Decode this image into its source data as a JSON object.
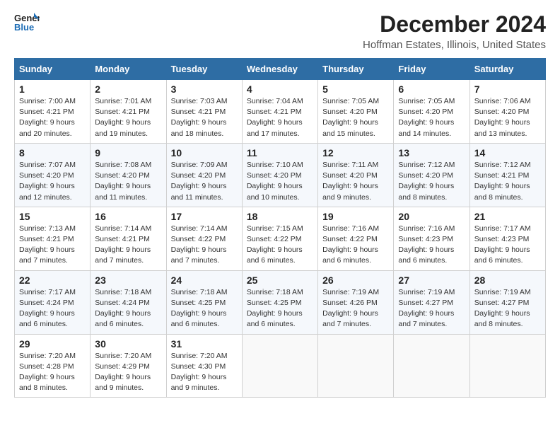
{
  "logo": {
    "line1": "General",
    "line2": "Blue"
  },
  "title": "December 2024",
  "location": "Hoffman Estates, Illinois, United States",
  "days_of_week": [
    "Sunday",
    "Monday",
    "Tuesday",
    "Wednesday",
    "Thursday",
    "Friday",
    "Saturday"
  ],
  "weeks": [
    [
      {
        "day": "1",
        "sunrise": "7:00 AM",
        "sunset": "4:21 PM",
        "daylight": "9 hours and 20 minutes."
      },
      {
        "day": "2",
        "sunrise": "7:01 AM",
        "sunset": "4:21 PM",
        "daylight": "9 hours and 19 minutes."
      },
      {
        "day": "3",
        "sunrise": "7:03 AM",
        "sunset": "4:21 PM",
        "daylight": "9 hours and 18 minutes."
      },
      {
        "day": "4",
        "sunrise": "7:04 AM",
        "sunset": "4:21 PM",
        "daylight": "9 hours and 17 minutes."
      },
      {
        "day": "5",
        "sunrise": "7:05 AM",
        "sunset": "4:20 PM",
        "daylight": "9 hours and 15 minutes."
      },
      {
        "day": "6",
        "sunrise": "7:05 AM",
        "sunset": "4:20 PM",
        "daylight": "9 hours and 14 minutes."
      },
      {
        "day": "7",
        "sunrise": "7:06 AM",
        "sunset": "4:20 PM",
        "daylight": "9 hours and 13 minutes."
      }
    ],
    [
      {
        "day": "8",
        "sunrise": "7:07 AM",
        "sunset": "4:20 PM",
        "daylight": "9 hours and 12 minutes."
      },
      {
        "day": "9",
        "sunrise": "7:08 AM",
        "sunset": "4:20 PM",
        "daylight": "9 hours and 11 minutes."
      },
      {
        "day": "10",
        "sunrise": "7:09 AM",
        "sunset": "4:20 PM",
        "daylight": "9 hours and 11 minutes."
      },
      {
        "day": "11",
        "sunrise": "7:10 AM",
        "sunset": "4:20 PM",
        "daylight": "9 hours and 10 minutes."
      },
      {
        "day": "12",
        "sunrise": "7:11 AM",
        "sunset": "4:20 PM",
        "daylight": "9 hours and 9 minutes."
      },
      {
        "day": "13",
        "sunrise": "7:12 AM",
        "sunset": "4:20 PM",
        "daylight": "9 hours and 8 minutes."
      },
      {
        "day": "14",
        "sunrise": "7:12 AM",
        "sunset": "4:21 PM",
        "daylight": "9 hours and 8 minutes."
      }
    ],
    [
      {
        "day": "15",
        "sunrise": "7:13 AM",
        "sunset": "4:21 PM",
        "daylight": "9 hours and 7 minutes."
      },
      {
        "day": "16",
        "sunrise": "7:14 AM",
        "sunset": "4:21 PM",
        "daylight": "9 hours and 7 minutes."
      },
      {
        "day": "17",
        "sunrise": "7:14 AM",
        "sunset": "4:22 PM",
        "daylight": "9 hours and 7 minutes."
      },
      {
        "day": "18",
        "sunrise": "7:15 AM",
        "sunset": "4:22 PM",
        "daylight": "9 hours and 6 minutes."
      },
      {
        "day": "19",
        "sunrise": "7:16 AM",
        "sunset": "4:22 PM",
        "daylight": "9 hours and 6 minutes."
      },
      {
        "day": "20",
        "sunrise": "7:16 AM",
        "sunset": "4:23 PM",
        "daylight": "9 hours and 6 minutes."
      },
      {
        "day": "21",
        "sunrise": "7:17 AM",
        "sunset": "4:23 PM",
        "daylight": "9 hours and 6 minutes."
      }
    ],
    [
      {
        "day": "22",
        "sunrise": "7:17 AM",
        "sunset": "4:24 PM",
        "daylight": "9 hours and 6 minutes."
      },
      {
        "day": "23",
        "sunrise": "7:18 AM",
        "sunset": "4:24 PM",
        "daylight": "9 hours and 6 minutes."
      },
      {
        "day": "24",
        "sunrise": "7:18 AM",
        "sunset": "4:25 PM",
        "daylight": "9 hours and 6 minutes."
      },
      {
        "day": "25",
        "sunrise": "7:18 AM",
        "sunset": "4:25 PM",
        "daylight": "9 hours and 6 minutes."
      },
      {
        "day": "26",
        "sunrise": "7:19 AM",
        "sunset": "4:26 PM",
        "daylight": "9 hours and 7 minutes."
      },
      {
        "day": "27",
        "sunrise": "7:19 AM",
        "sunset": "4:27 PM",
        "daylight": "9 hours and 7 minutes."
      },
      {
        "day": "28",
        "sunrise": "7:19 AM",
        "sunset": "4:27 PM",
        "daylight": "9 hours and 8 minutes."
      }
    ],
    [
      {
        "day": "29",
        "sunrise": "7:20 AM",
        "sunset": "4:28 PM",
        "daylight": "9 hours and 8 minutes."
      },
      {
        "day": "30",
        "sunrise": "7:20 AM",
        "sunset": "4:29 PM",
        "daylight": "9 hours and 9 minutes."
      },
      {
        "day": "31",
        "sunrise": "7:20 AM",
        "sunset": "4:30 PM",
        "daylight": "9 hours and 9 minutes."
      },
      null,
      null,
      null,
      null
    ]
  ]
}
